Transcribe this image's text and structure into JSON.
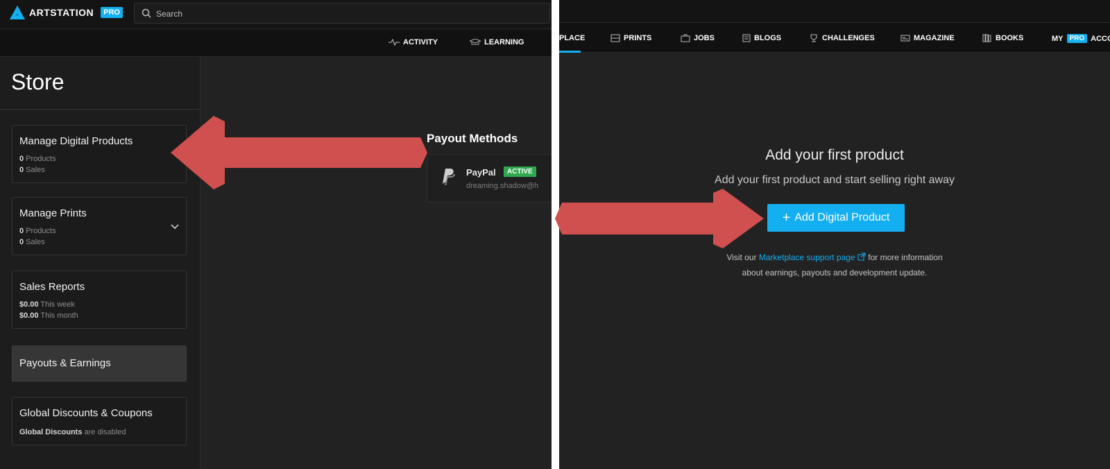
{
  "left": {
    "logo_text": "ARTSTATION",
    "logo_badge": "PRO",
    "search_placeholder": "Search",
    "subnav": [
      {
        "label": "ACTIVITY",
        "icon": "pulse-icon"
      },
      {
        "label": "LEARNING",
        "icon": "graduation-cap-icon"
      }
    ],
    "store_title": "Store",
    "cards": [
      {
        "title": "Manage Digital Products",
        "line1_num": "0",
        "line1_text": "Products",
        "line2_num": "0",
        "line2_text": "Sales"
      },
      {
        "title": "Manage Prints",
        "line1_num": "0",
        "line1_text": "Products",
        "line2_num": "0",
        "line2_text": "Sales"
      },
      {
        "title": "Sales Reports",
        "line1_num": "$0.00",
        "line1_text": "This week",
        "line2_num": "$0.00",
        "line2_text": "This month"
      },
      {
        "title": "Payouts & Earnings"
      },
      {
        "title": "Global Discounts & Coupons",
        "line1_num": "Global Discounts",
        "line1_text": "are disabled"
      }
    ],
    "payout": {
      "title": "Payout Methods",
      "method": "PayPal",
      "status": "ACTIVE",
      "email": "dreaming.shadow@h"
    }
  },
  "right": {
    "nav": [
      {
        "label": "PLACE"
      },
      {
        "label": "PRINTS",
        "icon": "prints-icon"
      },
      {
        "label": "JOBS",
        "icon": "briefcase-icon"
      },
      {
        "label": "BLOGS",
        "icon": "blog-icon"
      },
      {
        "label": "CHALLENGES",
        "icon": "trophy-icon"
      },
      {
        "label": "MAGAZINE",
        "icon": "magazine-icon"
      },
      {
        "label": "BOOKS",
        "icon": "books-icon"
      },
      {
        "label_prefix": "MY",
        "badge": "PRO",
        "label_suffix": "ACCO"
      }
    ],
    "empty_title": "Add your first product",
    "empty_sub": "Add your first product and start selling right away",
    "add_button": "Add Digital Product",
    "info_prefix": "Visit our",
    "info_link": "Marketplace support page",
    "info_suffix": "for more information",
    "info_line2": "about earnings, payouts and development update."
  },
  "colors": {
    "accent": "#13aff0",
    "arrow": "#d0504f",
    "active_badge": "#2fa84f",
    "background": "#222222"
  }
}
